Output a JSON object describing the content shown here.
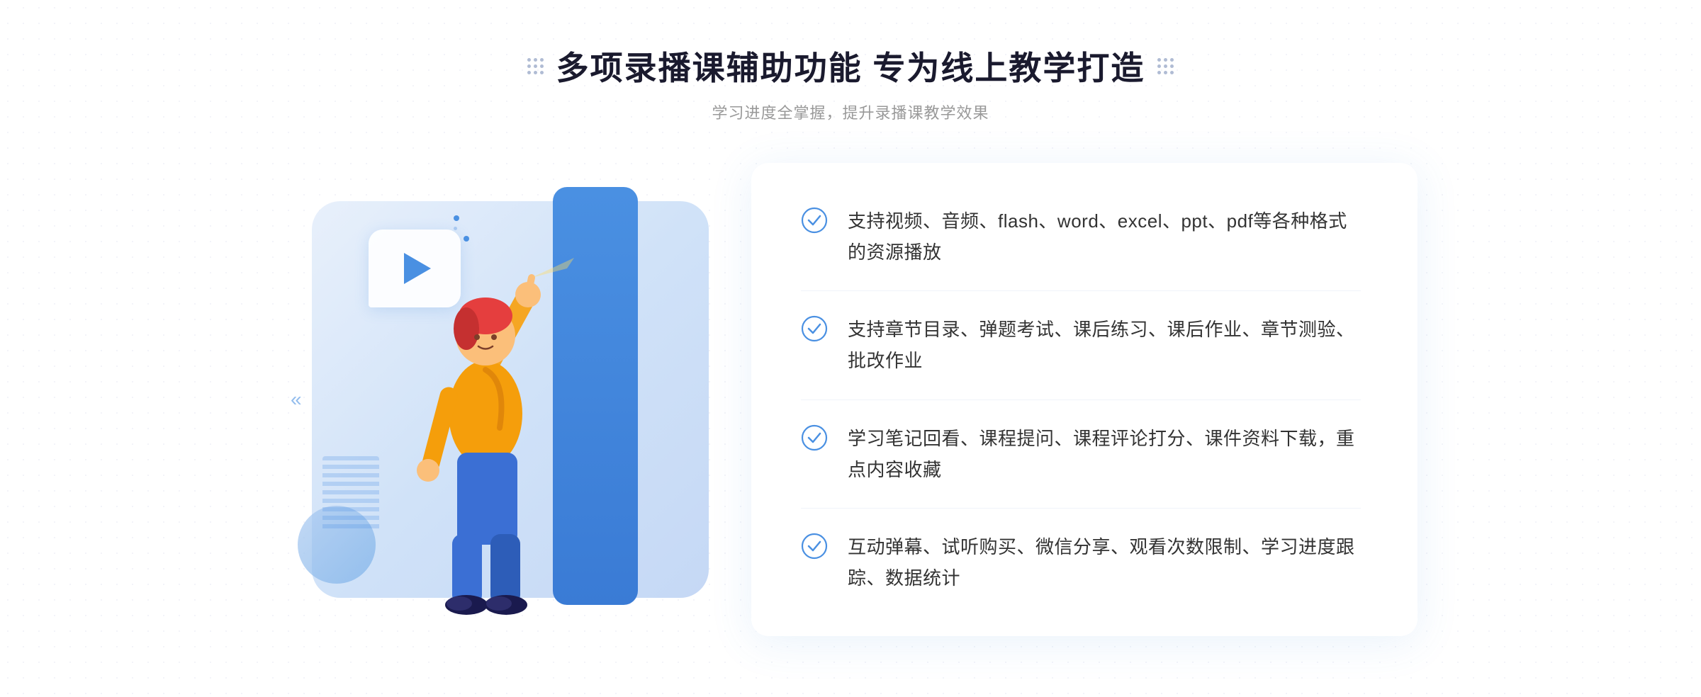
{
  "header": {
    "title": "多项录播课辅助功能 专为线上教学打造",
    "subtitle": "学习进度全掌握，提升录播课教学效果",
    "deco_left": "decorative-dots-left",
    "deco_right": "decorative-dots-right"
  },
  "features": [
    {
      "id": 1,
      "text": "支持视频、音频、flash、word、excel、ppt、pdf等各种格式的资源播放"
    },
    {
      "id": 2,
      "text": "支持章节目录、弹题考试、课后练习、课后作业、章节测验、批改作业"
    },
    {
      "id": 3,
      "text": "学习笔记回看、课程提问、课程评论打分、课件资料下载，重点内容收藏"
    },
    {
      "id": 4,
      "text": "互动弹幕、试听购买、微信分享、观看次数限制、学习进度跟踪、数据统计"
    }
  ],
  "colors": {
    "accent": "#4a90e2",
    "title": "#1a1a2e",
    "subtitle": "#999999",
    "text": "#333333",
    "check": "#4a90e2"
  },
  "illustration": {
    "play_icon": "▶",
    "chevrons": "«"
  }
}
